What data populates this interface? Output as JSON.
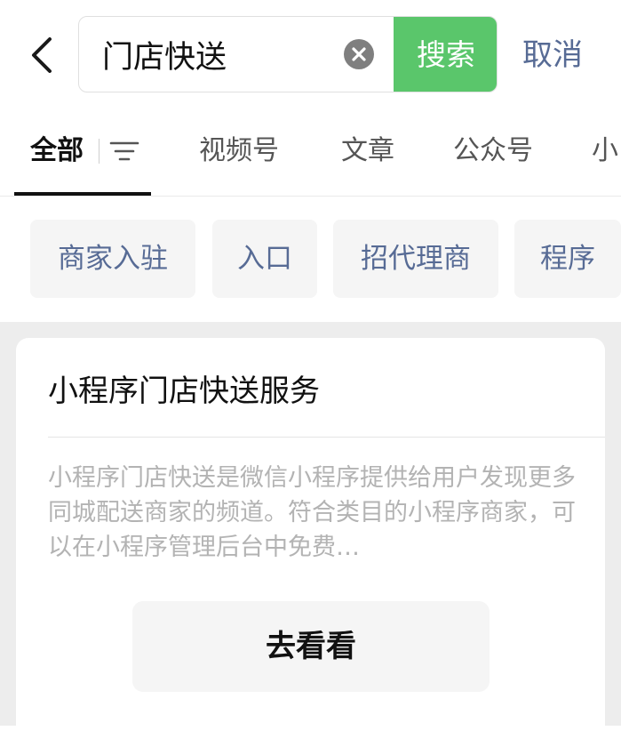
{
  "search": {
    "query": "门店快送",
    "button_label": "搜索",
    "cancel_label": "取消"
  },
  "tabs": [
    {
      "label": "全部"
    },
    {
      "label": "视频号"
    },
    {
      "label": "文章"
    },
    {
      "label": "公众号"
    },
    {
      "label": "小"
    }
  ],
  "suggestions": [
    {
      "label": "商家入驻"
    },
    {
      "label": "入口"
    },
    {
      "label": "招代理商"
    },
    {
      "label": "程序"
    }
  ],
  "result_card": {
    "title": "小程序门店快送服务",
    "description": "小程序门店快送是微信小程序提供给用户发现更多同城配送商家的频道。符合类目的小程序商家，可以在小程序管理后台中免费…",
    "action_label": "去看看"
  },
  "colors": {
    "accent_green": "#5ac66b",
    "link_blue": "#576b95",
    "page_gray": "#ededed"
  },
  "icons": [
    "back-arrow-icon",
    "clear-icon",
    "filter-icon"
  ]
}
